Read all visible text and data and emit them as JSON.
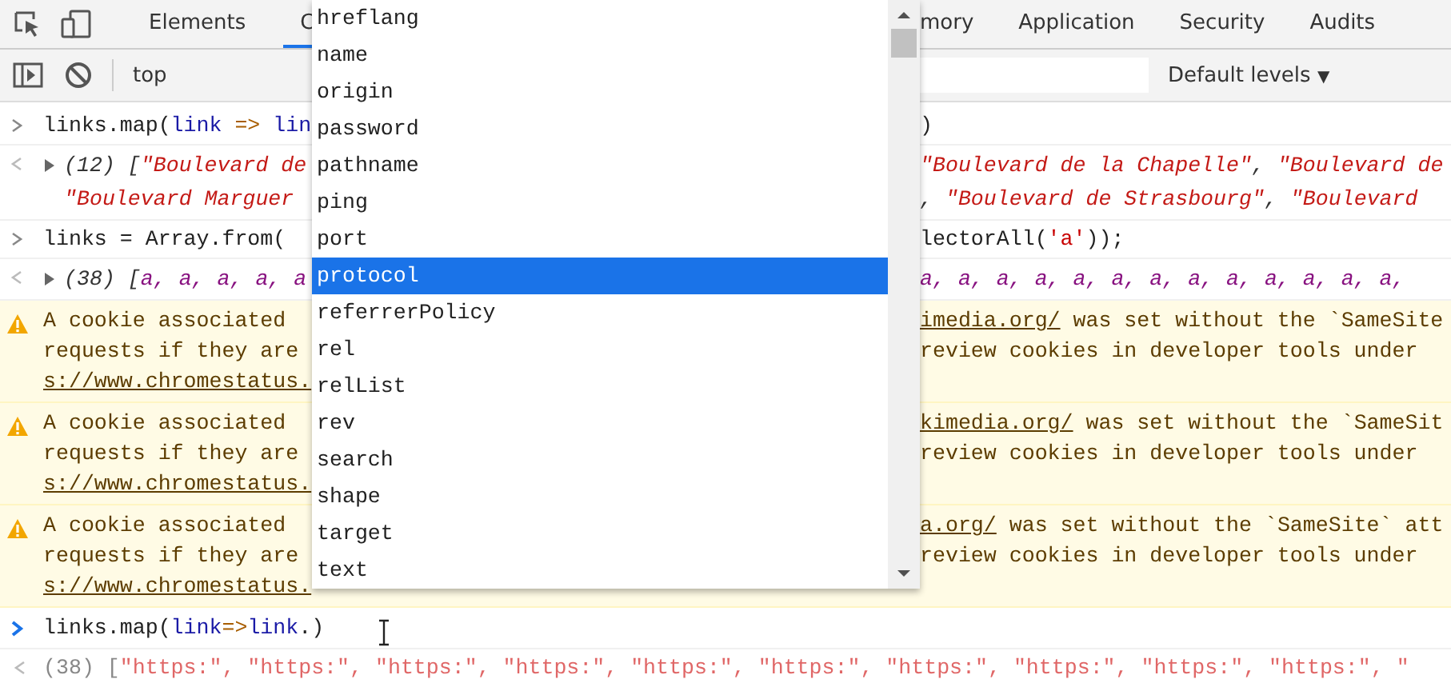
{
  "tabs": [
    {
      "label": "Elements",
      "selected": false
    },
    {
      "label": "C",
      "selected": true
    },
    {
      "label": "mory",
      "selected": false
    },
    {
      "label": "Application",
      "selected": false
    },
    {
      "label": "Security",
      "selected": false
    },
    {
      "label": "Audits",
      "selected": false
    }
  ],
  "toolbar": {
    "context": "top",
    "levels": "Default levels",
    "levels_caret": "▼"
  },
  "console": [
    {
      "kind": "input",
      "lines": [
        {
          "left": [
            {
              "t": "links.map(",
              "kind": "plain"
            },
            {
              "t": "link",
              "kind": "var"
            },
            {
              "t": " => ",
              "kind": "op"
            },
            {
              "t": "lin",
              "kind": "var"
            }
          ],
          "right": [
            {
              "t": ")",
              "kind": "plain"
            }
          ]
        }
      ]
    },
    {
      "kind": "output",
      "expanded": false,
      "lines": [
        {
          "left": [
            {
              "t": "(12) [",
              "kind": "plain"
            },
            {
              "t": "\"Boulevard de",
              "kind": "string"
            }
          ],
          "right": [
            {
              "t": "\"Boulevard de la Chapelle\"",
              "kind": "string"
            },
            {
              "t": ", ",
              "kind": "plain"
            },
            {
              "t": "\"Boulevard de",
              "kind": "string"
            }
          ]
        },
        {
          "left": [
            {
              "t": "\"Boulevard Marguer",
              "kind": "string"
            }
          ],
          "right": [
            {
              "t": ", ",
              "kind": "plain"
            },
            {
              "t": "\"Boulevard de Strasbourg\"",
              "kind": "string"
            },
            {
              "t": ", ",
              "kind": "plain"
            },
            {
              "t": "\"Boulevard",
              "kind": "string"
            }
          ]
        }
      ]
    },
    {
      "kind": "input",
      "lines": [
        {
          "left": [
            {
              "t": "links = Array.from(",
              "kind": "plain"
            }
          ],
          "right": [
            {
              "t": "lectorAll(",
              "kind": "plain"
            },
            {
              "t": "'a'",
              "kind": "literal"
            },
            {
              "t": "));",
              "kind": "plain"
            }
          ]
        }
      ]
    },
    {
      "kind": "output",
      "expanded": false,
      "lines": [
        {
          "left": [
            {
              "t": "(38) [",
              "kind": "plain"
            },
            {
              "t": "a, a, a, a, a",
              "kind": "node"
            }
          ],
          "right": [
            {
              "t": "a, a, a, a, a, a, a, a, a, a, a, a, a,",
              "kind": "node"
            }
          ]
        }
      ]
    },
    {
      "kind": "warning",
      "lines": [
        {
          "left": [
            {
              "t": "A cookie associated",
              "kind": "plain"
            }
          ],
          "right": [
            {
              "t": "imedia.org/",
              "kind": "link"
            },
            {
              "t": " was set without the `SameSite",
              "kind": "plain"
            }
          ]
        },
        {
          "left": [
            {
              "t": "requests if they are",
              "kind": "plain"
            }
          ],
          "right": [
            {
              "t": "review cookies in developer tools under",
              "kind": "plain"
            }
          ]
        },
        {
          "left": [
            {
              "t": "s://www.chromestatus.",
              "kind": "link"
            }
          ]
        }
      ]
    },
    {
      "kind": "warning",
      "lines": [
        {
          "left": [
            {
              "t": "A cookie associated",
              "kind": "plain"
            }
          ],
          "right": [
            {
              "t": "kimedia.org/",
              "kind": "link"
            },
            {
              "t": " was set without the `SameSit",
              "kind": "plain"
            }
          ]
        },
        {
          "left": [
            {
              "t": "requests if they are",
              "kind": "plain"
            }
          ],
          "right": [
            {
              "t": "review cookies in developer tools under",
              "kind": "plain"
            }
          ]
        },
        {
          "left": [
            {
              "t": "s://www.chromestatus.",
              "kind": "link"
            }
          ]
        }
      ]
    },
    {
      "kind": "warning",
      "lines": [
        {
          "left": [
            {
              "t": "A cookie associated",
              "kind": "plain"
            }
          ],
          "right": [
            {
              "t": "a.org/",
              "kind": "link"
            },
            {
              "t": " was set without the `SameSite` att",
              "kind": "plain"
            }
          ]
        },
        {
          "left": [
            {
              "t": "requests if they are",
              "kind": "plain"
            }
          ],
          "right": [
            {
              "t": "review cookies in developer tools under",
              "kind": "plain"
            }
          ]
        },
        {
          "left": [
            {
              "t": "s://www.chromestatus.",
              "kind": "link"
            }
          ]
        }
      ]
    },
    {
      "kind": "prompt",
      "lines": [
        {
          "left": [
            {
              "t": "links.map(",
              "kind": "plain"
            },
            {
              "t": "link",
              "kind": "var"
            },
            {
              "t": "=>",
              "kind": "op"
            },
            {
              "t": "link",
              "kind": "var"
            },
            {
              "t": ".)",
              "kind": "plain"
            }
          ]
        }
      ]
    },
    {
      "kind": "result",
      "lines": [
        {
          "full": [
            {
              "t": "(38) [",
              "kind": "plain"
            },
            {
              "t": "\"https:\", \"https:\", \"https:\", \"https:\", \"https:\", \"https:\", \"https:\", \"https:\", \"https:\", \"https:\", \"",
              "kind": "faint"
            }
          ]
        }
      ]
    }
  ],
  "autocomplete": [
    {
      "label": "hreflang",
      "selected": false
    },
    {
      "label": "name",
      "selected": false
    },
    {
      "label": "origin",
      "selected": false
    },
    {
      "label": "password",
      "selected": false
    },
    {
      "label": "pathname",
      "selected": false
    },
    {
      "label": "ping",
      "selected": false
    },
    {
      "label": "port",
      "selected": false
    },
    {
      "label": "protocol",
      "selected": true
    },
    {
      "label": "referrerPolicy",
      "selected": false
    },
    {
      "label": "rel",
      "selected": false
    },
    {
      "label": "relList",
      "selected": false
    },
    {
      "label": "rev",
      "selected": false
    },
    {
      "label": "search",
      "selected": false
    },
    {
      "label": "shape",
      "selected": false
    },
    {
      "label": "target",
      "selected": false
    },
    {
      "label": "text",
      "selected": false
    }
  ]
}
